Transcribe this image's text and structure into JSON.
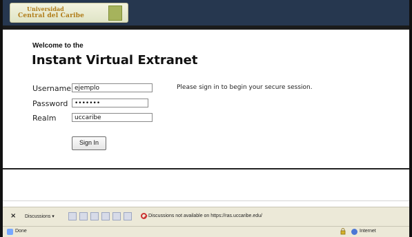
{
  "header": {
    "logo_line1": "Universidad",
    "logo_line2": "Central del Caribe"
  },
  "login": {
    "welcome_line": "Welcome to the",
    "title": "Instant Virtual Extranet",
    "username_label": "Username",
    "username_value": "ejemplo",
    "password_label": "Password",
    "password_value": "•••••••",
    "realm_label": "Realm",
    "realm_value": "uccaribe",
    "signin_button": "Sign In",
    "message": "Please sign in to begin your secure session."
  },
  "discussions": {
    "close_label": "×",
    "label": "Discussions ▾",
    "message": "Discussions not available on https://ras.uccaribe.edu/"
  },
  "statusbar": {
    "status": "Done",
    "zone": "Internet"
  }
}
